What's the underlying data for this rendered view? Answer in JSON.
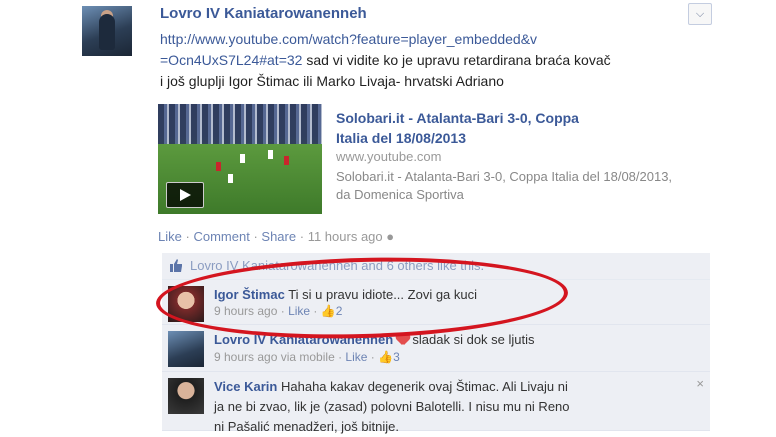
{
  "post": {
    "author": "Lovro IV Kaniatarowanenneh",
    "url_line1": "http://www.youtube.com/watch?feature=player_embedded&v",
    "url_line2": "=Ocn4UxS7L24#at=32",
    "text_line1": " sad vi vidite ko je upravu retardirana braća kovač",
    "text_line2": "i još gluplji Igor Štimac ili Marko Livaja- hrvatski Adriano",
    "menu_icon": "chevron-down-icon"
  },
  "link_card": {
    "title": "Solobari.it - Atalanta-Bari 3-0, Coppa Italia del 18/08/2013",
    "domain": "www.youtube.com",
    "description": "Solobari.it - Atalanta-Bari 3-0, Coppa Italia del 18/08/2013, da Domenica Sportiva",
    "play_icon": "play-icon"
  },
  "actions": {
    "like": "Like",
    "comment": "Comment",
    "share": "Share",
    "time": "11 hours ago",
    "sep": "·"
  },
  "likes_summary": "Lovro IV Kaniatarowanenneh and 6 others like this.",
  "comments": [
    {
      "name": "Igor Štimac",
      "text": "Ti si u pravu idiote... Zovi ga kuci",
      "time": "9 hours ago",
      "like": "Like",
      "likes": "2"
    },
    {
      "name": "Lovro IV Kaniatarowanenneh",
      "text": "sladak si dok se ljutis",
      "time": "9 hours ago via mobile",
      "like": "Like",
      "likes": "3"
    },
    {
      "name": "Vice Karin",
      "text_line1": "Hahaha kakav degenerik ovaj Štimac. Ali Livaju ni",
      "text_line2": "ja ne bi zvao, lik je (zasad) polovni Balotelli. I nisu mu ni Reno",
      "text_line3": "ni Pašalić menadžeri, još bitnije.",
      "close": "×"
    }
  ],
  "colors": {
    "link": "#3b5998",
    "comment_bg": "#edeff4",
    "highlight_oval": "#d4151f"
  }
}
